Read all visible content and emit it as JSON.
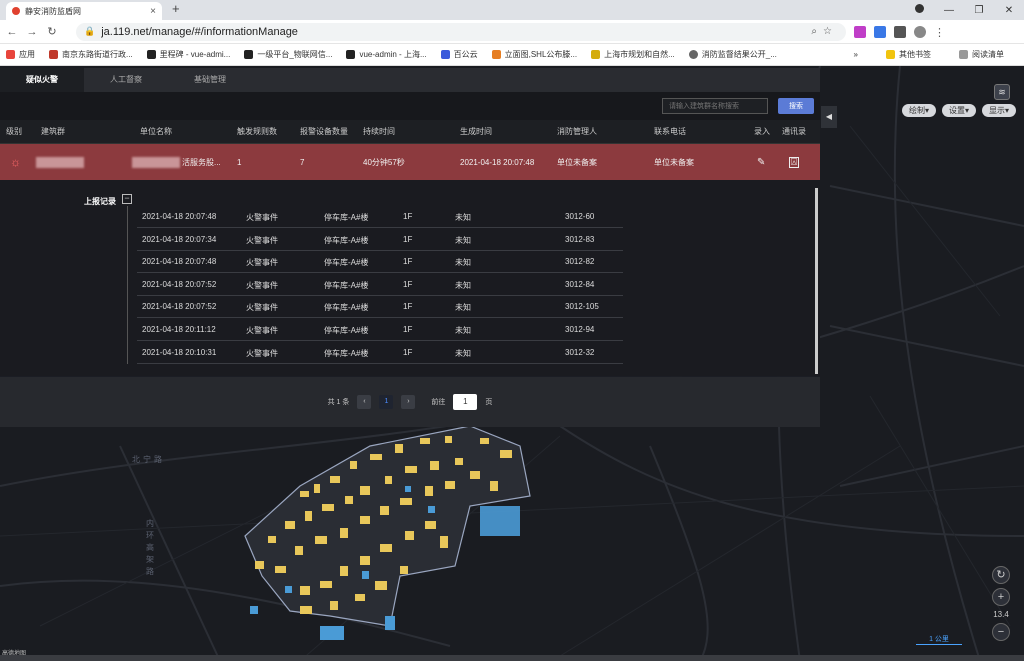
{
  "browser": {
    "tab_title": "静安消防监盾网",
    "tab_close": "×",
    "new_tab": "+",
    "url": "ja.119.net/manage/#/informationManage",
    "bookmarks": [
      "应用",
      "南京东路街道行政...",
      "里程碑 - vue-admi...",
      "一级平台_物联网信...",
      "vue-admin - 上海...",
      "百公云",
      "立面图,SHL公布滕...",
      "上海市规划和自然...",
      "消防监督结果公开_..."
    ],
    "bookmarks_more": "»",
    "other_bookmarks": "其他书签",
    "reading_list": "阅读清单",
    "ext_colors": [
      "#c03ec8",
      "#3a78e6",
      "#555555",
      "#888888"
    ]
  },
  "map": {
    "labels": [
      {
        "text": "北宁路"
      },
      {
        "text": "内环高架路"
      }
    ],
    "tools": [
      "绘制▾",
      "设置▾",
      "显示▾"
    ],
    "zoom_in": "+",
    "zoom_out": "−",
    "zoom_level": "13.4",
    "scale": "1 公里",
    "logo": "高德地图"
  },
  "panel": {
    "tabs": [
      "疑似火警",
      "人工督察",
      "基础管理"
    ],
    "active_tab": 0,
    "search_placeholder": "请输入建筑群名称搜索",
    "search_button": "搜索",
    "columns": [
      "级别",
      "建筑群",
      "单位名称",
      "触发规则数",
      "报警设备数量",
      "持续时间",
      "生成时间",
      "消防管理人",
      "联系电话",
      "录入",
      "通讯录"
    ],
    "alarm_row": {
      "level_icon": "☼",
      "building": "",
      "unit_suffix": "活服务股...",
      "rule_count": "1",
      "device_count": "7",
      "duration": "40分钟57秒",
      "created": "2021-04-18 20:07:48",
      "manager": "单位未备案",
      "phone": "单位未备案",
      "edit_icon": "✎",
      "contacts_icon": "⍓"
    },
    "records_title": "上报记录",
    "records_toggle": "−",
    "records": [
      {
        "time": "2021-04-18 20:07:48",
        "type": "火警事件",
        "place": "停车库-A#楼",
        "floor": "1F",
        "status": "未知",
        "code": "3012-60"
      },
      {
        "time": "2021-04-18 20:07:34",
        "type": "火警事件",
        "place": "停车库-A#楼",
        "floor": "1F",
        "status": "未知",
        "code": "3012-83"
      },
      {
        "time": "2021-04-18 20:07:48",
        "type": "火警事件",
        "place": "停车库-A#楼",
        "floor": "1F",
        "status": "未知",
        "code": "3012-82"
      },
      {
        "time": "2021-04-18 20:07:52",
        "type": "火警事件",
        "place": "停车库-A#楼",
        "floor": "1F",
        "status": "未知",
        "code": "3012-84"
      },
      {
        "time": "2021-04-18 20:07:52",
        "type": "火警事件",
        "place": "停车库-A#楼",
        "floor": "1F",
        "status": "未知",
        "code": "3012-105"
      },
      {
        "time": "2021-04-18 20:11:12",
        "type": "火警事件",
        "place": "停车库-A#楼",
        "floor": "1F",
        "status": "未知",
        "code": "3012-94"
      },
      {
        "time": "2021-04-18 20:10:31",
        "type": "火警事件",
        "place": "停车库-A#楼",
        "floor": "1F",
        "status": "未知",
        "code": "3012-32"
      }
    ],
    "pager": {
      "total": "共 1 条",
      "prev": "‹",
      "page": "1",
      "next": "›",
      "goto_label": "前往",
      "goto_value": "1",
      "page_unit": "页"
    },
    "collapse_handle": "◀"
  },
  "colors": {
    "alarm_row": "#8c3a3e",
    "search_button": "#5b7bd6",
    "building_yellow": "#e8c75a",
    "building_blue": "#4a9bd6"
  }
}
